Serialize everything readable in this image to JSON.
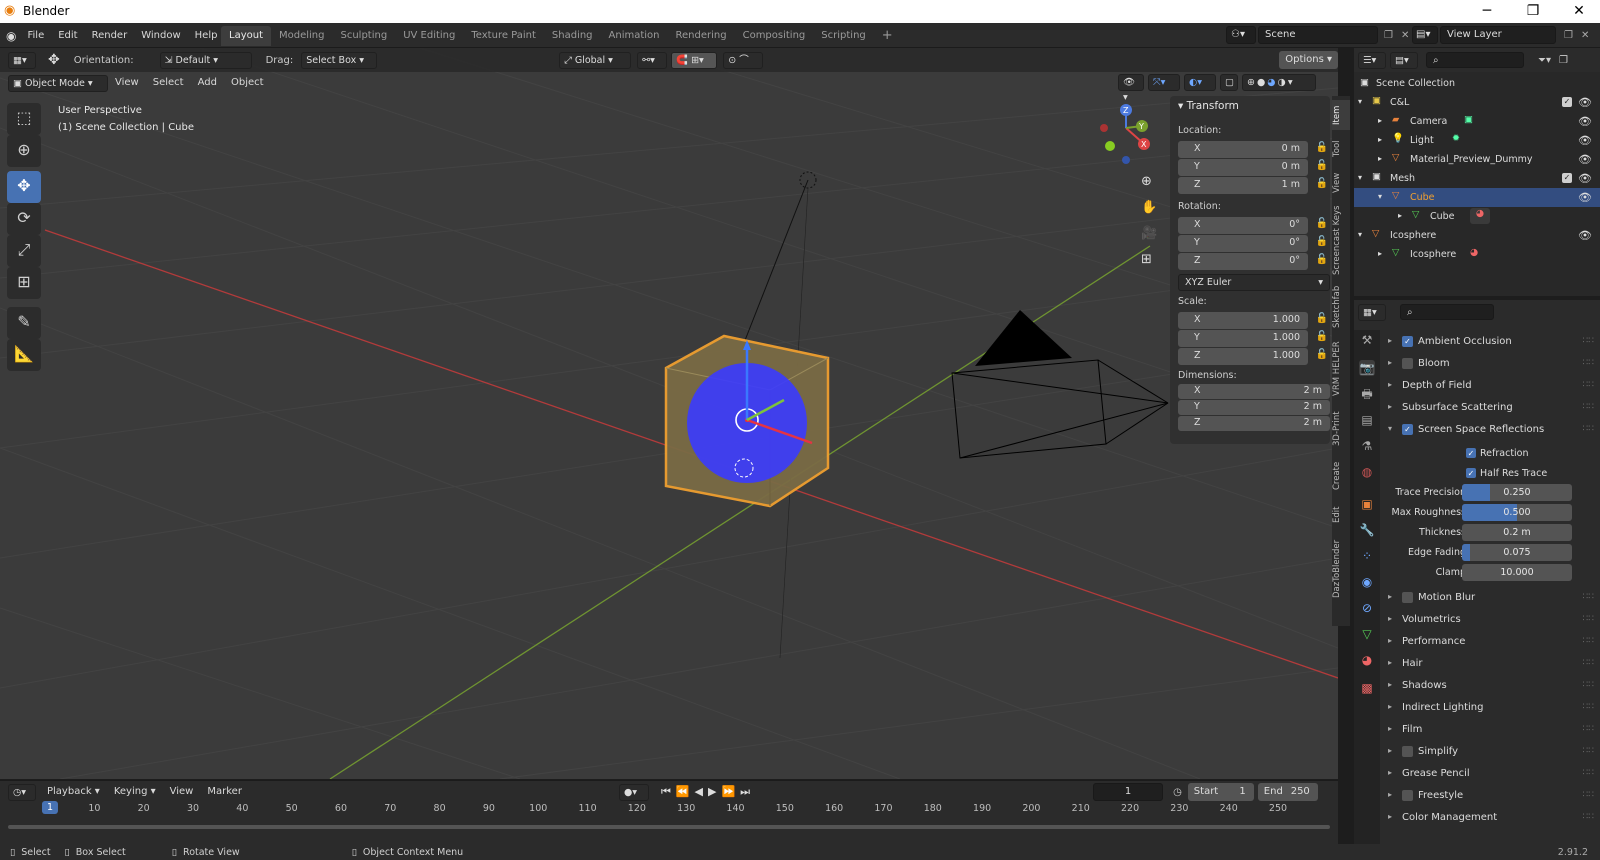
{
  "app": {
    "title": "Blender",
    "version": "2.91.2"
  },
  "menus": [
    "File",
    "Edit",
    "Render",
    "Window",
    "Help"
  ],
  "workspaces": [
    "Layout",
    "Modeling",
    "Sculpting",
    "UV Editing",
    "Texture Paint",
    "Shading",
    "Animation",
    "Rendering",
    "Compositing",
    "Scripting"
  ],
  "active_workspace": "Layout",
  "scene": {
    "name": "Scene",
    "view_layer": "View Layer"
  },
  "tool_header": {
    "orientation_label": "Orientation:",
    "orientation_value": "Default",
    "drag_label": "Drag:",
    "drag_value": "Select Box",
    "transform_orientation": "Global",
    "options": "Options"
  },
  "view_header": {
    "mode": "Object Mode",
    "menus": [
      "View",
      "Select",
      "Add",
      "Object"
    ]
  },
  "viewport": {
    "perspective": "User Perspective",
    "collection_info": "(1) Scene Collection | Cube",
    "accent_x_axis": "#c64343",
    "accent_y_axis": "#7aa12d",
    "selection_outline": "#f0a030"
  },
  "n_panel": {
    "title": "Transform",
    "location_label": "Location:",
    "location": [
      {
        "axis": "X",
        "value": "0 m"
      },
      {
        "axis": "Y",
        "value": "0 m"
      },
      {
        "axis": "Z",
        "value": "1 m"
      }
    ],
    "rotation_label": "Rotation:",
    "rotation": [
      {
        "axis": "X",
        "value": "0°"
      },
      {
        "axis": "Y",
        "value": "0°"
      },
      {
        "axis": "Z",
        "value": "0°"
      }
    ],
    "rotation_mode": "XYZ Euler",
    "scale_label": "Scale:",
    "scale": [
      {
        "axis": "X",
        "value": "1.000"
      },
      {
        "axis": "Y",
        "value": "1.000"
      },
      {
        "axis": "Z",
        "value": "1.000"
      }
    ],
    "dimensions_label": "Dimensions:",
    "dimensions": [
      {
        "axis": "X",
        "value": "2 m"
      },
      {
        "axis": "Y",
        "value": "2 m"
      },
      {
        "axis": "Z",
        "value": "2 m"
      }
    ]
  },
  "side_tabs": [
    "Item",
    "Tool",
    "View",
    "Screencast Keys",
    "Sketchfab",
    "VRM HELPER",
    "3D-Print",
    "Create",
    "Edit",
    "DazToBlender"
  ],
  "outliner": {
    "root": "Scene Collection",
    "rows": [
      {
        "label": "C&L",
        "type": "collection",
        "checked": true
      },
      {
        "label": "Camera",
        "type": "camera"
      },
      {
        "label": "Light",
        "type": "light"
      },
      {
        "label": "Material_Preview_Dummy",
        "type": "mesh"
      },
      {
        "label": "Mesh",
        "type": "collection",
        "checked": true
      },
      {
        "label": "Cube",
        "type": "mesh",
        "selected": true
      },
      {
        "label": "Cube",
        "type": "meshdata"
      },
      {
        "label": "Icosphere",
        "type": "mesh"
      },
      {
        "label": "Icosphere",
        "type": "meshdata"
      }
    ]
  },
  "properties": {
    "panels": [
      {
        "label": "Ambient Occlusion",
        "checkbox": true,
        "checked": true
      },
      {
        "label": "Bloom",
        "checkbox": true,
        "checked": false
      },
      {
        "label": "Depth of Field",
        "checkbox": false
      },
      {
        "label": "Subsurface Scattering",
        "checkbox": false
      },
      {
        "label": "Screen Space Reflections",
        "checkbox": true,
        "checked": true,
        "expanded": true
      }
    ],
    "ssr": {
      "refraction": "Refraction",
      "half_res": "Half Res Trace",
      "fields": [
        {
          "label": "Trace Precision",
          "value": "0.250",
          "fill": 0.25
        },
        {
          "label": "Max Roughness",
          "value": "0.500",
          "fill": 0.5
        },
        {
          "label": "Thickness",
          "value": "0.2 m",
          "fill": 0
        },
        {
          "label": "Edge Fading",
          "value": "0.075",
          "fill": 0.075
        },
        {
          "label": "Clamp",
          "value": "10.000",
          "fill": 0
        }
      ]
    },
    "more_panels": [
      {
        "label": "Motion Blur",
        "checkbox": true,
        "checked": false
      },
      {
        "label": "Volumetrics",
        "checkbox": false
      },
      {
        "label": "Performance",
        "checkbox": false
      },
      {
        "label": "Hair",
        "checkbox": false
      },
      {
        "label": "Shadows",
        "checkbox": false
      },
      {
        "label": "Indirect Lighting",
        "checkbox": false
      },
      {
        "label": "Film",
        "checkbox": false
      },
      {
        "label": "Simplify",
        "checkbox": true,
        "checked": false
      },
      {
        "label": "Grease Pencil",
        "checkbox": false
      },
      {
        "label": "Freestyle",
        "checkbox": true,
        "checked": false
      },
      {
        "label": "Color Management",
        "checkbox": false
      }
    ]
  },
  "timeline": {
    "menus": [
      "Playback",
      "Keying",
      "View",
      "Marker"
    ],
    "current_frame": "1",
    "start_label": "Start",
    "start": "1",
    "end_label": "End",
    "end": "250",
    "ruler": [
      "1",
      "10",
      "20",
      "30",
      "40",
      "50",
      "60",
      "70",
      "80",
      "90",
      "100",
      "110",
      "120",
      "130",
      "140",
      "150",
      "160",
      "170",
      "180",
      "190",
      "200",
      "210",
      "220",
      "230",
      "240",
      "250"
    ]
  },
  "statusbar": [
    {
      "label": "Select"
    },
    {
      "label": "Box Select"
    },
    {
      "label": "Rotate View"
    },
    {
      "label": "Object Context Menu"
    }
  ]
}
